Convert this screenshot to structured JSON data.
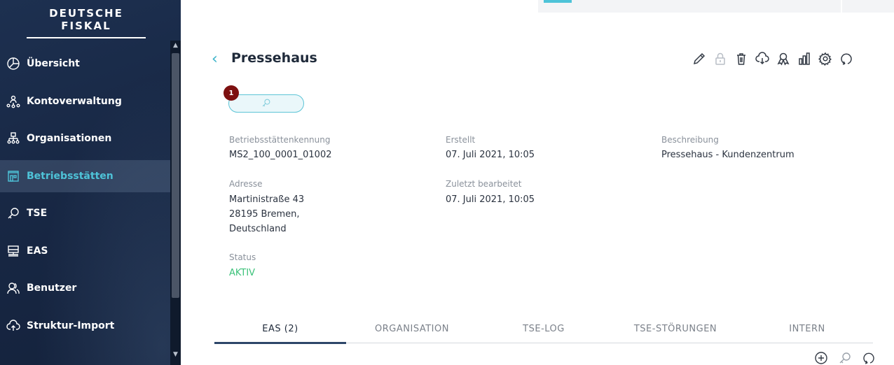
{
  "sidebar": {
    "brand": "DEUTSCHE FISKAL",
    "items": [
      {
        "label": "Übersicht",
        "icon": "pie-chart-icon"
      },
      {
        "label": "Kontoverwaltung",
        "icon": "account-network-icon"
      },
      {
        "label": "Organisationen",
        "icon": "org-chart-icon"
      },
      {
        "label": "Betriebsstätten",
        "icon": "building-icon",
        "active": true
      },
      {
        "label": "TSE",
        "icon": "key-icon"
      },
      {
        "label": "EAS",
        "icon": "computer-icon"
      },
      {
        "label": "Benutzer",
        "icon": "users-icon"
      },
      {
        "label": "Struktur-Import",
        "icon": "cloud-upload-icon"
      }
    ]
  },
  "header": {
    "title": "Pressehaus",
    "actions": [
      "edit-icon",
      "lock-icon",
      "trash-icon",
      "cloud-download-icon",
      "award-icon",
      "chart-icon",
      "settings-icon",
      "refresh-icon"
    ]
  },
  "key_badge": {
    "count": "1"
  },
  "details": {
    "kennung_label": "Betriebsstättenkennung",
    "kennung_value": "MS2_100_0001_01002",
    "erstellt_label": "Erstellt",
    "erstellt_value": "07. Juli 2021, 10:05",
    "beschreibung_label": "Beschreibung",
    "beschreibung_value": "Pressehaus - Kundenzentrum",
    "adresse_label": "Adresse",
    "adresse_line1": "Martinistraße 43",
    "adresse_line2": "28195 Bremen,",
    "adresse_line3": "Deutschland",
    "bearbeitet_label": "Zuletzt bearbeitet",
    "bearbeitet_value": "07. Juli 2021, 10:05",
    "status_label": "Status",
    "status_value": "AKTIV"
  },
  "tabs": [
    {
      "label": "EAS (2)",
      "active": true
    },
    {
      "label": "ORGANISATION"
    },
    {
      "label": "TSE-LOG"
    },
    {
      "label": "TSE-STÖRUNGEN"
    },
    {
      "label": "INTERN"
    }
  ],
  "colors": {
    "sidebar_bg": "#182845",
    "accent": "#4ec3d8",
    "status_active": "#3cc27a",
    "badge": "#7d1010"
  }
}
